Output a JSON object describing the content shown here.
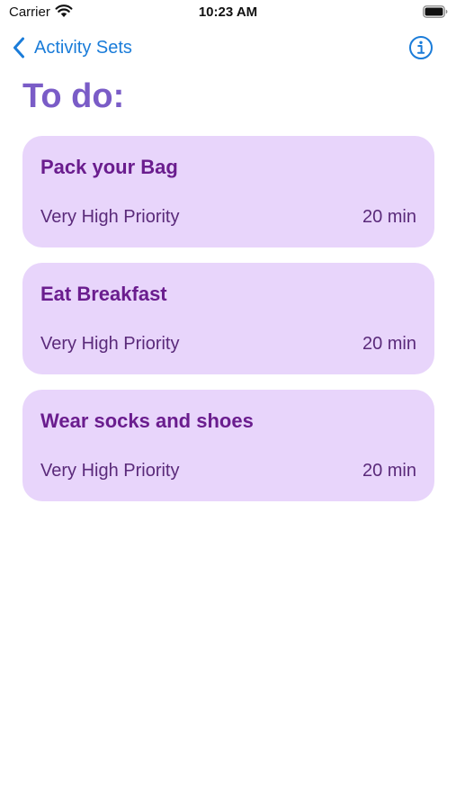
{
  "status_bar": {
    "carrier": "Carrier",
    "time": "10:23 AM",
    "icons": [
      "wifi-icon",
      "battery-icon"
    ]
  },
  "nav": {
    "back_label": "Activity Sets",
    "back_icon": "chevron-left-icon",
    "info_icon": "info-circle-icon",
    "accent_color": "#1a7cd9"
  },
  "page": {
    "title": "To do:",
    "title_color": "#7a5cc7"
  },
  "activities": [
    {
      "title": "Pack your Bag",
      "priority": "Very High Priority",
      "duration": "20 min"
    },
    {
      "title": "Eat Breakfast",
      "priority": "Very High Priority",
      "duration": "20 min"
    },
    {
      "title": "Wear socks and shoes",
      "priority": "Very High Priority",
      "duration": "20 min"
    }
  ],
  "colors": {
    "card_background": "#e8d5fb",
    "card_title": "#6a1d8e",
    "card_text": "#5a2a7a"
  }
}
